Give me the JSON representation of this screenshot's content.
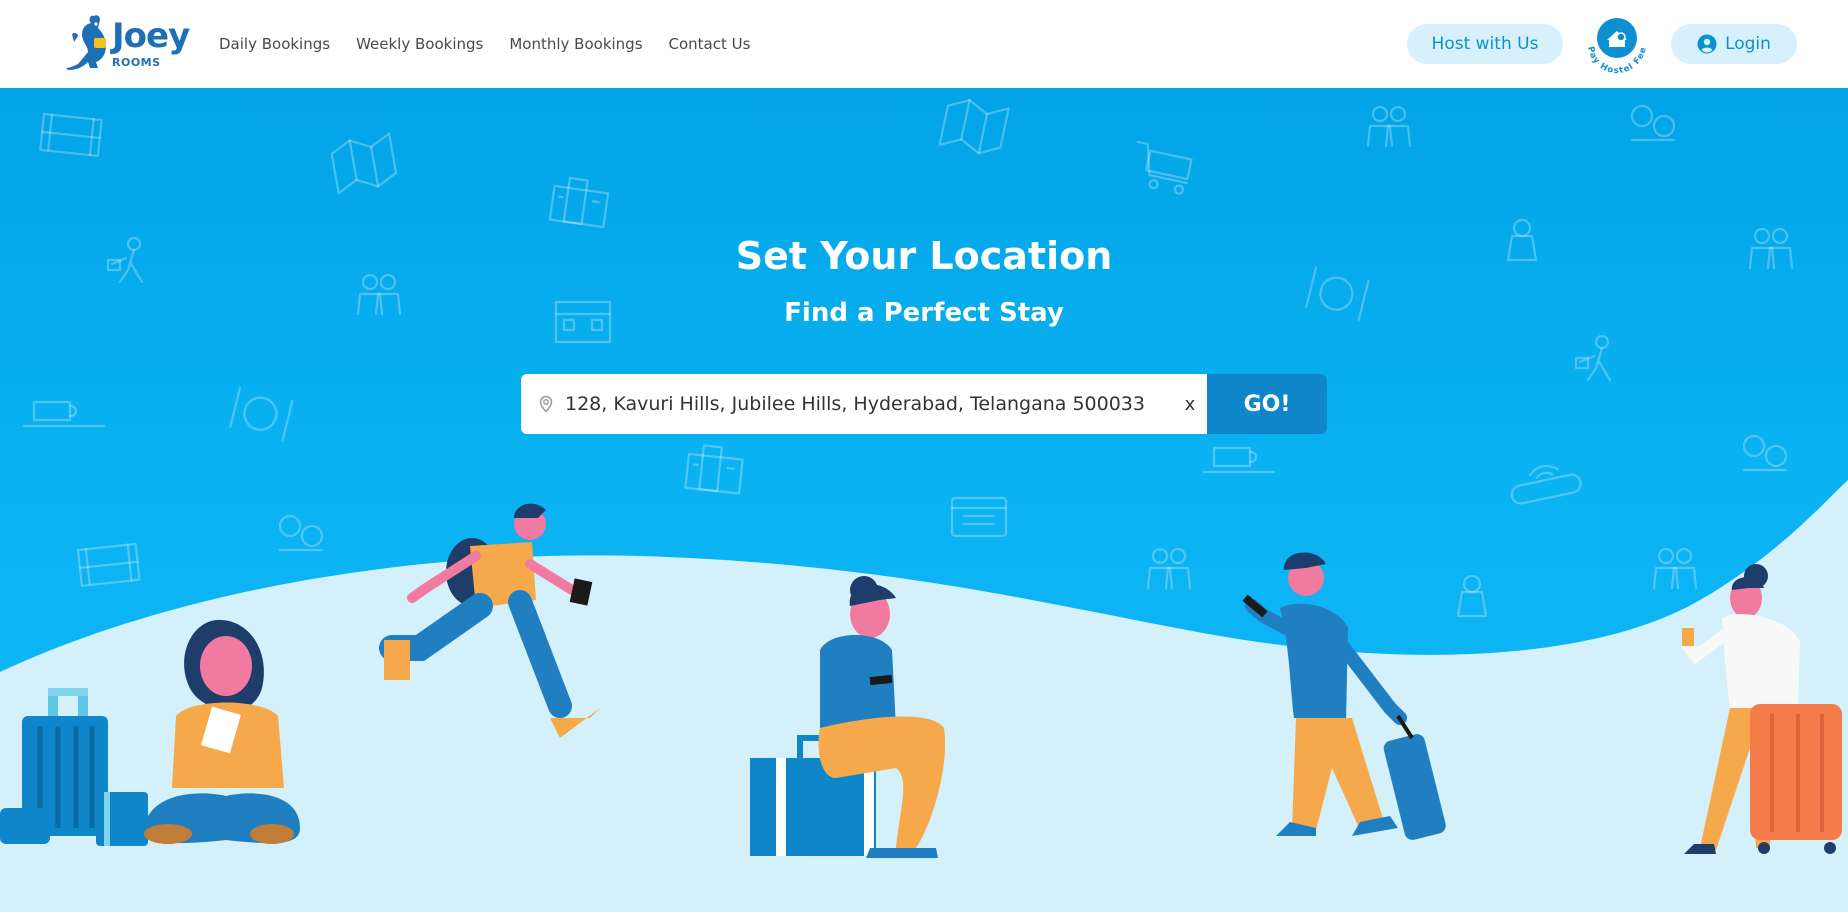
{
  "header": {
    "logo": {
      "word": "Joey",
      "sub": "ROOMS"
    },
    "nav": [
      {
        "label": "Daily Bookings"
      },
      {
        "label": "Weekly Bookings"
      },
      {
        "label": "Monthly Bookings"
      },
      {
        "label": "Contact Us"
      }
    ],
    "host_label": "Host with Us",
    "pay_badge_text": "Pay Hostel Fee",
    "login_label": "Login"
  },
  "hero": {
    "title": "Set Your Location",
    "subtitle": "Find a Perfect Stay",
    "search": {
      "value": "128, Kavuri Hills, Jubilee Hills, Hyderabad, Telangana 500033",
      "clear_label": "x",
      "go_label": "GO!"
    }
  },
  "colors": {
    "brand": "#1f6fb4",
    "hero_bg": "#02a4e6",
    "ground": "#d4f0fb",
    "go_button": "#0f86c9",
    "pill": "#d6f1fc"
  },
  "icons": [
    "location-pin-icon",
    "user-circle-icon",
    "house-coin-icon",
    "kangaroo-logo-icon"
  ]
}
